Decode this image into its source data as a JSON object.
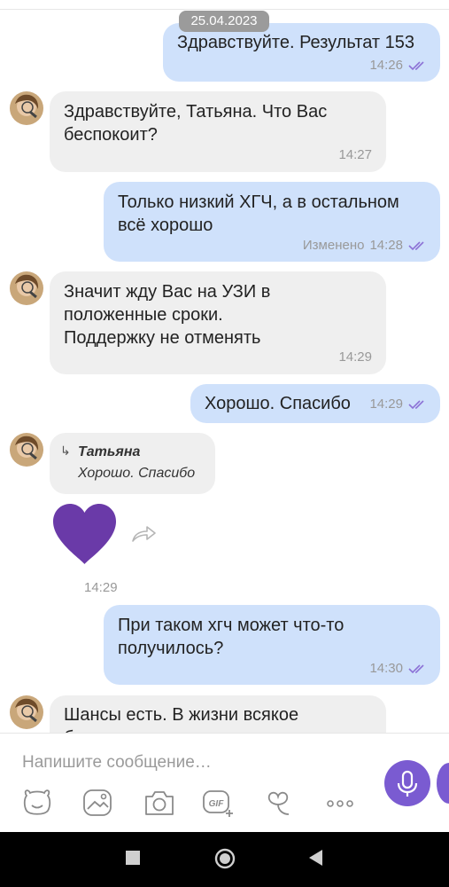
{
  "date_separator": "25.04.2023",
  "messages": [
    {
      "direction": "out",
      "text": "Здравствуйте. Результат 153",
      "time": "14:26",
      "status": "read"
    },
    {
      "direction": "in",
      "text": "Здравствуйте, Татьяна.  Что Вас беспокоит?",
      "time": "14:27"
    },
    {
      "direction": "out",
      "text": "Только низкий ХГЧ, а в остальном всё хорошо",
      "edited_label": "Изменено",
      "time": "14:28",
      "status": "read"
    },
    {
      "direction": "in",
      "text": "Значит жду Вас на УЗИ в положенные сроки. Поддержку не отменять",
      "time": "14:29"
    },
    {
      "direction": "out",
      "text": "Хорошо. Спасибо",
      "time": "14:29",
      "status": "read"
    },
    {
      "direction": "in",
      "quote": {
        "author": "Татьяна",
        "text": "Хорошо. Спасибо"
      },
      "sticker": "purple-heart",
      "time": "14:29"
    },
    {
      "direction": "out",
      "text": "При таком хгч может что-то получилось?",
      "time": "14:30",
      "status": "read"
    },
    {
      "direction": "in",
      "text": "Шансы есть.  В жизни всякое бывает"
    }
  ],
  "composer": {
    "placeholder": "Напишите сообщение…",
    "toolbar": [
      "sticker-icon",
      "gallery-icon",
      "camera-icon",
      "gif-icon",
      "doodle-icon",
      "more-icon"
    ],
    "send_button": "microphone-icon"
  },
  "colors": {
    "accent": "#7a5bd1",
    "outgoing_bubble": "#cfe1fb",
    "incoming_bubble": "#efefef",
    "ticks": "#8c72d6"
  }
}
